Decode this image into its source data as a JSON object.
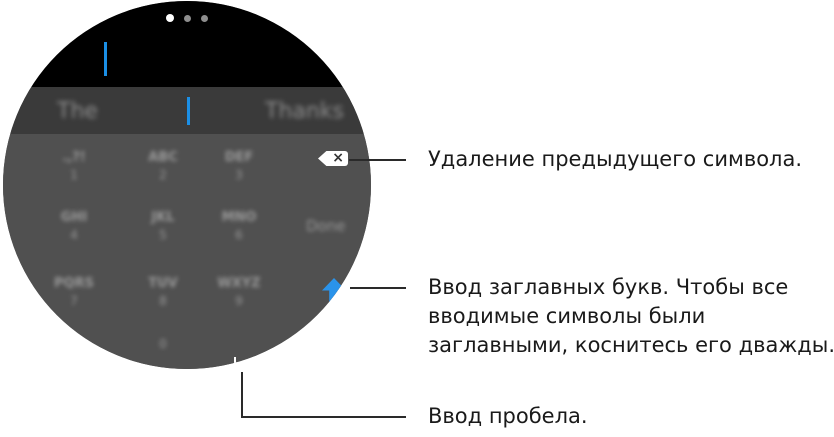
{
  "page_indicator": {
    "count": 3,
    "active": 1
  },
  "suggestions": [
    "The",
    "Thanks"
  ],
  "keys": [
    {
      "main": ".,?!",
      "num": "1"
    },
    {
      "main": "ABC",
      "num": "2"
    },
    {
      "main": "DEF",
      "num": "3"
    },
    {
      "main": "GHI",
      "num": "4"
    },
    {
      "main": "JKL",
      "num": "5"
    },
    {
      "main": "MNO",
      "num": "6"
    },
    {
      "main": "PQRS",
      "num": "7"
    },
    {
      "main": "TUV",
      "num": "8"
    },
    {
      "main": "WXYZ",
      "num": "9"
    },
    {
      "main": "",
      "num": "0"
    }
  ],
  "done_label": "Done",
  "icons": {
    "backspace": "backspace-icon",
    "shift": "shift-icon",
    "space": "space-icon"
  },
  "callouts": {
    "delete": "Удаление предыдущего символа.",
    "caps_line1": "Ввод заглавных букв. Чтобы все",
    "caps_line2": "вводимые символы были",
    "caps_line3": "заглавными, коснитесь его дважды.",
    "space": "Ввод пробела."
  },
  "colors": {
    "cursor": "#1b8fe6",
    "shift": "#2a93ea",
    "keypad_bg": "#505050"
  }
}
